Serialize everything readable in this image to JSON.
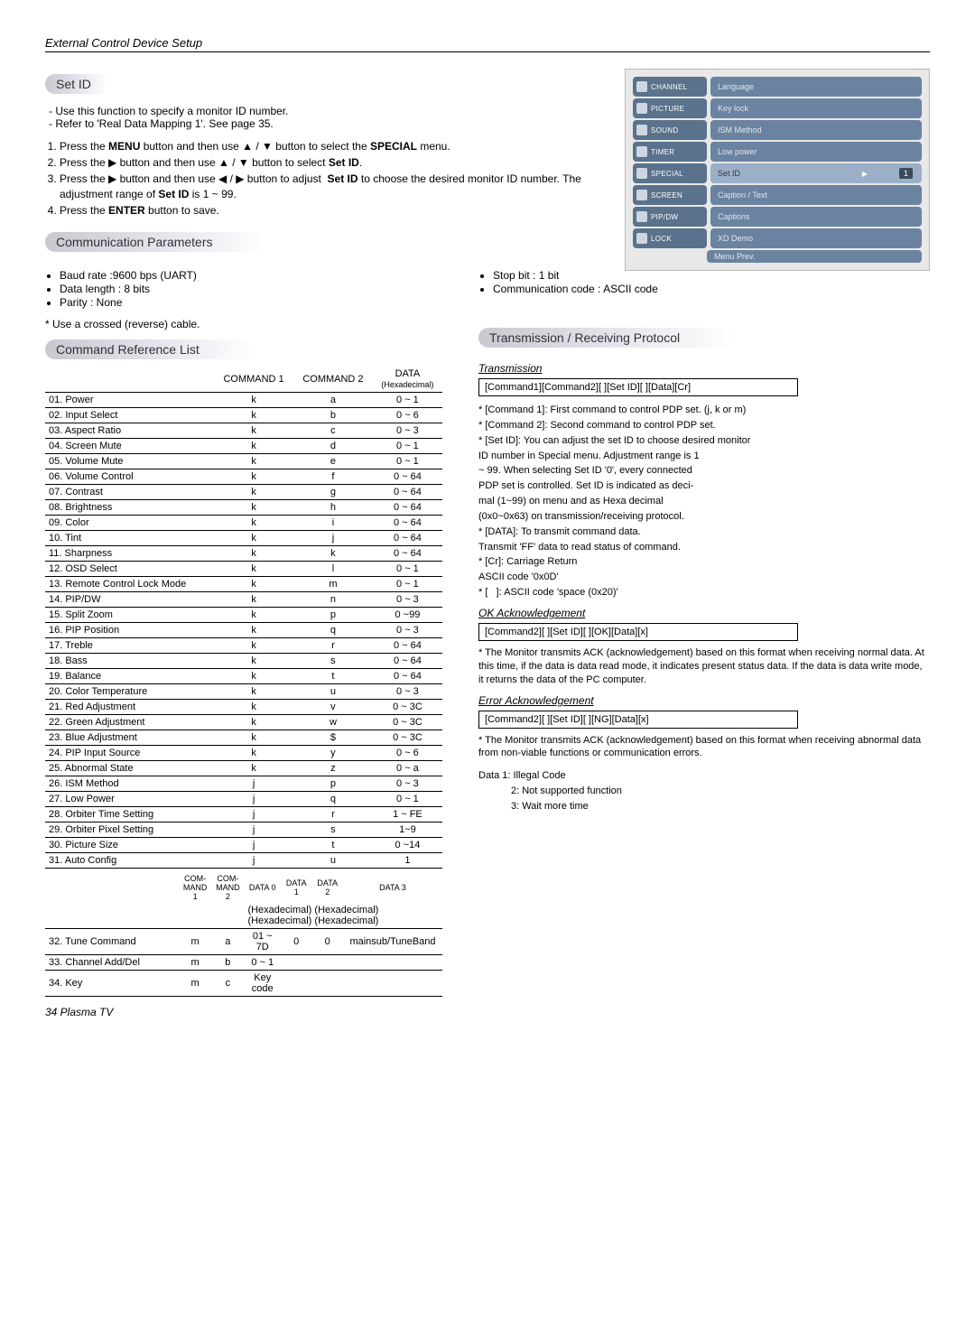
{
  "header": {
    "title": "External Control Device Setup"
  },
  "setid": {
    "title": "Set ID",
    "intro": [
      "Use this function to specify a monitor ID number.",
      "Refer to 'Real Data Mapping 1'. See page 35."
    ],
    "steps": [
      "Press the MENU button and then use ▲ / ▼ button to select the SPECIAL menu.",
      "Press the ▶ button and then use ▲ / ▼ button to select Set ID.",
      "Press the ▶ button and then use ◀ / ▶ button to adjust Set ID to choose the desired monitor ID number. The adjustment range of Set ID is 1 ~ 99.",
      "Press the ENTER button to save."
    ]
  },
  "osd": {
    "tabs": [
      "CHANNEL",
      "PICTURE",
      "SOUND",
      "TIMER",
      "SPECIAL",
      "SCREEN",
      "PIP/DW",
      "LOCK"
    ],
    "items": [
      "Language",
      "Key lock",
      "ISM Method",
      "Low power",
      "Set ID",
      "Caption / Text",
      "Captions",
      "XD Demo"
    ],
    "selected_index": 4,
    "value": "1",
    "footer": "Menu   Prev."
  },
  "comm": {
    "title": "Communication Parameters",
    "left": [
      "Baud rate :9600 bps (UART)",
      "Data length : 8 bits",
      "Parity : None"
    ],
    "right": [
      "Stop bit : 1 bit",
      "Communication code : ASCII code"
    ],
    "note": "* Use a crossed (reverse) cable."
  },
  "cmdref": {
    "title": "Command Reference List",
    "headers": [
      "",
      "COMMAND 1",
      "COMMAND 2",
      "DATA"
    ],
    "subheader": "(Hexadecimal)",
    "rows": [
      [
        "01. Power",
        "k",
        "a",
        "0 ~ 1"
      ],
      [
        "02. Input Select",
        "k",
        "b",
        "0 ~ 6"
      ],
      [
        "03. Aspect Ratio",
        "k",
        "c",
        "0 ~ 3"
      ],
      [
        "04. Screen Mute",
        "k",
        "d",
        "0 ~ 1"
      ],
      [
        "05. Volume Mute",
        "k",
        "e",
        "0 ~ 1"
      ],
      [
        "06. Volume Control",
        "k",
        "f",
        "0 ~ 64"
      ],
      [
        "07. Contrast",
        "k",
        "g",
        "0 ~ 64"
      ],
      [
        "08. Brightness",
        "k",
        "h",
        "0 ~ 64"
      ],
      [
        "09. Color",
        "k",
        "i",
        "0 ~ 64"
      ],
      [
        "10. Tint",
        "k",
        "j",
        "0 ~ 64"
      ],
      [
        "11. Sharpness",
        "k",
        "k",
        "0 ~ 64"
      ],
      [
        "12. OSD Select",
        "k",
        "l",
        "0 ~ 1"
      ],
      [
        "13. Remote Control Lock Mode",
        "k",
        "m",
        "0 ~ 1"
      ],
      [
        "14. PIP/DW",
        "k",
        "n",
        "0 ~ 3"
      ],
      [
        "15. Split Zoom",
        "k",
        "p",
        "0 ~99"
      ],
      [
        "16. PIP Position",
        "k",
        "q",
        "0 ~ 3"
      ],
      [
        "17. Treble",
        "k",
        "r",
        "0 ~ 64"
      ],
      [
        "18. Bass",
        "k",
        "s",
        "0 ~ 64"
      ],
      [
        "19. Balance",
        "k",
        "t",
        "0 ~ 64"
      ],
      [
        "20. Color Temperature",
        "k",
        "u",
        "0 ~ 3"
      ],
      [
        "21. Red Adjustment",
        "k",
        "v",
        "0 ~ 3C"
      ],
      [
        "22. Green Adjustment",
        "k",
        "w",
        "0 ~ 3C"
      ],
      [
        "23. Blue Adjustment",
        "k",
        "$",
        "0 ~ 3C"
      ],
      [
        "24. PIP Input Source",
        "k",
        "y",
        "0 ~ 6"
      ],
      [
        "25. Abnormal State",
        "k",
        "z",
        "0 ~ a"
      ],
      [
        "26. ISM Method",
        "j",
        "p",
        "0 ~ 3"
      ],
      [
        "27. Low Power",
        "j",
        "q",
        "0 ~ 1"
      ],
      [
        "28. Orbiter Time Setting",
        "j",
        "r",
        "1 ~ FE"
      ],
      [
        "29. Orbiter Pixel Setting",
        "j",
        "s",
        "1~9"
      ],
      [
        "30. Picture Size",
        "j",
        "t",
        "0 ~14"
      ],
      [
        "31. Auto Config",
        "j",
        "u",
        "1"
      ]
    ],
    "ext_headers": [
      "",
      "COM-\nMAND 1",
      "COM-\nMAND 2",
      "DATA 0",
      "DATA 1",
      "DATA 2",
      "DATA 3"
    ],
    "ext_sub": "(Hexadecimal) (Hexadecimal) (Hexadecimal) (Hexadecimal)",
    "ext_rows": [
      [
        "32. Tune Command",
        "m",
        "a",
        "01 ~ 7D",
        "0",
        "0",
        "mainsub/TuneBand"
      ],
      [
        "33. Channel Add/Del",
        "m",
        "b",
        "0 ~ 1",
        "",
        "",
        ""
      ],
      [
        "34. Key",
        "m",
        "c",
        "Key code",
        "",
        "",
        ""
      ]
    ]
  },
  "protocol": {
    "title": "Transmission / Receiving  Protocol",
    "trans_title": "Transmission",
    "trans_box": "[Command1][Command2][  ][Set ID][  ][Data][Cr]",
    "trans_notes": [
      "* [Command 1]: First command to control PDP set. (j, k or m)",
      "* [Command 2]: Second command to control PDP set.",
      "* [Set ID]: You can adjust the set ID to choose desired monitor ID number in Special menu. Adjustment range is 1 ~ 99. When selecting Set ID '0', every connected PDP set is controlled. Set ID is indicated as decimal (1~99) on menu and as Hexa decimal (0x0~0x63) on transmission/receiving protocol.",
      "* [DATA]: To transmit command data.",
      "  Transmit 'FF' data to read status of command.",
      "* [Cr]: Carriage Return",
      "  ASCII code '0x0D'",
      "* [   ]: ASCII code 'space (0x20)'"
    ],
    "ok_title": "OK Acknowledgement",
    "ok_box": "[Command2][  ][Set ID][  ][OK][Data][x]",
    "ok_note": "* The Monitor transmits ACK (acknowledgement) based on this format when receiving normal data. At this time, if the data is data read mode, it indicates present status data. If the data is data write mode, it returns the data of the PC computer.",
    "err_title": "Error Acknowledgement",
    "err_box": "[Command2][  ][Set ID][  ][NG][Data][x]",
    "err_note": "* The Monitor transmits ACK (acknowledgement) based on this format when receiving abnormal data from non-viable functions or communication errors.",
    "data_codes": [
      "Data 1: Illegal Code",
      "2: Not supported function",
      "3: Wait more time"
    ]
  },
  "footer": {
    "text": "34  Plasma TV"
  }
}
